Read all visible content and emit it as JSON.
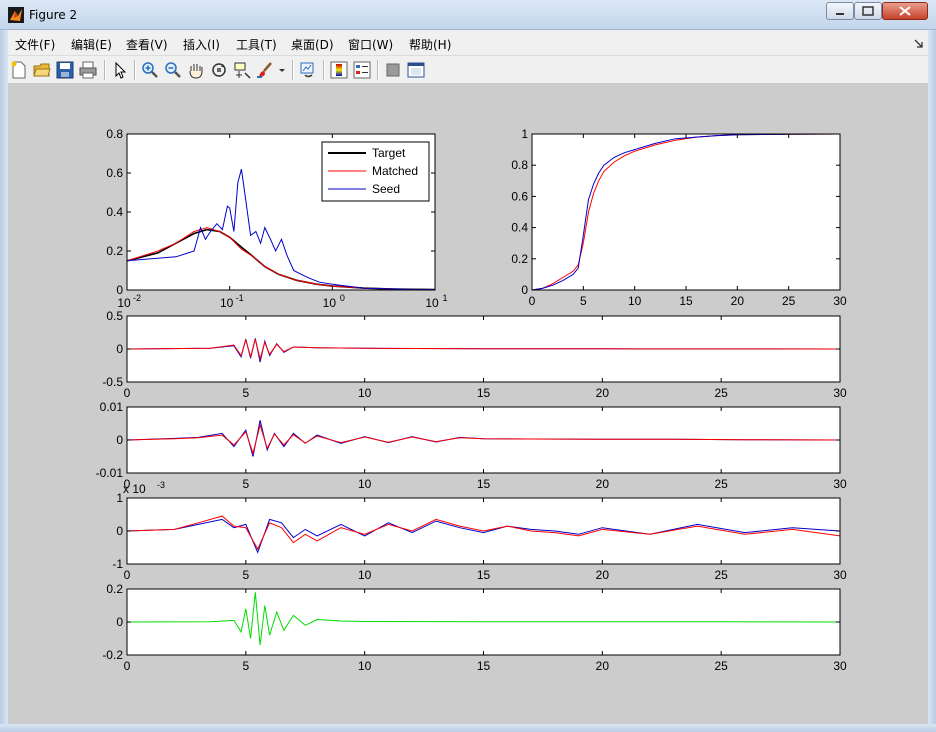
{
  "window": {
    "title": "Figure 2",
    "minimize_icon": "minimize-icon",
    "maximize_icon": "maximize-icon",
    "close_icon": "close-icon"
  },
  "menu": [
    {
      "label": "文件(F)"
    },
    {
      "label": "编辑(E)"
    },
    {
      "label": "查看(V)"
    },
    {
      "label": "插入(I)"
    },
    {
      "label": "工具(T)"
    },
    {
      "label": "桌面(D)"
    },
    {
      "label": "窗口(W)"
    },
    {
      "label": "帮助(H)"
    }
  ],
  "toolbar": {
    "icons": [
      "new-figure-icon",
      "open-file-icon",
      "save-icon",
      "print-icon",
      "arrow-cursor-icon",
      "zoom-in-icon",
      "zoom-out-icon",
      "pan-icon",
      "rotate-3d-icon",
      "data-cursor-icon",
      "brush-icon",
      "dropdown-arrow-icon",
      "link-plot-icon",
      "insert-colorbar-icon",
      "insert-legend-icon",
      "hide-plot-tools-icon",
      "show-plot-tools-icon"
    ]
  },
  "colors": {
    "target": "#000000",
    "matched": "#ff0000",
    "seed": "#0000cc",
    "diff": "#00dd00",
    "figure_bg": "#cccccc"
  },
  "chart_data": [
    {
      "type": "line",
      "xscale": "log",
      "xlim": [
        0.01,
        10
      ],
      "ylim": [
        0,
        0.8
      ],
      "yticks": [
        "0",
        "0.2",
        "0.4",
        "0.6",
        "0.8"
      ],
      "xticks": [
        {
          "base": "10",
          "exp": "-2"
        },
        {
          "base": "10",
          "exp": "-1"
        },
        {
          "base": "10",
          "exp": "0"
        },
        {
          "base": "10",
          "exp": "1"
        }
      ],
      "legend_position": "top-right",
      "series": [
        {
          "name": "Target",
          "color": "#000000",
          "x": [
            0.01,
            0.02,
            0.03,
            0.045,
            0.06,
            0.08,
            0.1,
            0.13,
            0.17,
            0.22,
            0.3,
            0.45,
            0.7,
            1,
            2,
            4,
            10
          ],
          "y": [
            0.15,
            0.19,
            0.24,
            0.29,
            0.31,
            0.3,
            0.27,
            0.22,
            0.17,
            0.12,
            0.08,
            0.05,
            0.03,
            0.02,
            0.01,
            0.005,
            0.002
          ]
        },
        {
          "name": "Matched",
          "color": "#ff0000",
          "x": [
            0.01,
            0.02,
            0.03,
            0.045,
            0.06,
            0.08,
            0.1,
            0.13,
            0.17,
            0.22,
            0.3,
            0.45,
            0.7,
            1,
            2,
            4,
            10
          ],
          "y": [
            0.15,
            0.2,
            0.24,
            0.3,
            0.32,
            0.3,
            0.27,
            0.21,
            0.17,
            0.12,
            0.08,
            0.05,
            0.03,
            0.02,
            0.01,
            0.005,
            0.002
          ]
        },
        {
          "name": "Seed",
          "color": "#0000cc",
          "x": [
            0.01,
            0.03,
            0.045,
            0.052,
            0.058,
            0.065,
            0.075,
            0.085,
            0.095,
            0.1,
            0.11,
            0.12,
            0.13,
            0.14,
            0.16,
            0.18,
            0.2,
            0.22,
            0.25,
            0.28,
            0.32,
            0.36,
            0.42,
            0.5,
            0.6,
            0.75,
            1,
            2,
            4,
            10
          ],
          "y": [
            0.15,
            0.17,
            0.2,
            0.32,
            0.26,
            0.3,
            0.34,
            0.31,
            0.43,
            0.42,
            0.3,
            0.55,
            0.62,
            0.5,
            0.28,
            0.3,
            0.24,
            0.32,
            0.26,
            0.2,
            0.26,
            0.18,
            0.1,
            0.08,
            0.06,
            0.04,
            0.03,
            0.01,
            0.005,
            0.002
          ]
        }
      ]
    },
    {
      "type": "line",
      "xlim": [
        0,
        30
      ],
      "ylim": [
        0,
        1
      ],
      "xticks": [
        "0",
        "5",
        "10",
        "15",
        "20",
        "25",
        "30"
      ],
      "yticks": [
        "0",
        "0.2",
        "0.4",
        "0.6",
        "0.8",
        "1"
      ],
      "series": [
        {
          "color": "#ff0000",
          "x": [
            0,
            1,
            2,
            3,
            4,
            4.5,
            5,
            5.5,
            6,
            6.5,
            7,
            8,
            9,
            10,
            12,
            14,
            16,
            18,
            20,
            25,
            30
          ],
          "y": [
            0,
            0.01,
            0.04,
            0.08,
            0.12,
            0.16,
            0.3,
            0.5,
            0.62,
            0.7,
            0.76,
            0.82,
            0.86,
            0.89,
            0.93,
            0.96,
            0.98,
            0.99,
            0.995,
            0.998,
            1
          ]
        },
        {
          "color": "#0000cc",
          "x": [
            0,
            1,
            2,
            3,
            4,
            4.5,
            5,
            5.5,
            6,
            6.5,
            7,
            8,
            9,
            10,
            12,
            14,
            16,
            18,
            20,
            25,
            30
          ],
          "y": [
            0,
            0.01,
            0.03,
            0.06,
            0.1,
            0.14,
            0.35,
            0.58,
            0.68,
            0.75,
            0.8,
            0.85,
            0.88,
            0.9,
            0.94,
            0.97,
            0.98,
            0.99,
            0.995,
            0.998,
            1
          ]
        }
      ]
    },
    {
      "type": "line",
      "xlim": [
        0,
        30
      ],
      "ylim": [
        -0.5,
        0.5
      ],
      "xticks": [
        "0",
        "5",
        "10",
        "15",
        "20",
        "25",
        "30"
      ],
      "yticks": [
        "-0.5",
        "0",
        "0.5"
      ],
      "series": [
        {
          "color": "#0000cc",
          "x": [
            0,
            3.5,
            4.5,
            4.8,
            5,
            5.2,
            5.4,
            5.6,
            5.8,
            6,
            6.3,
            6.6,
            7,
            8,
            10,
            15,
            20,
            25,
            30
          ],
          "y": [
            0,
            0.01,
            0.05,
            -0.12,
            0.15,
            -0.14,
            0.16,
            -0.2,
            0.12,
            -0.1,
            0.08,
            -0.05,
            0.03,
            0.02,
            0.01,
            0.005,
            0.003,
            0.002,
            0
          ]
        },
        {
          "color": "#ff0000",
          "x": [
            0,
            3.5,
            4.5,
            4.8,
            5,
            5.2,
            5.4,
            5.6,
            5.8,
            6,
            6.3,
            6.6,
            7,
            8,
            10,
            15,
            20,
            25,
            30
          ],
          "y": [
            0,
            0.01,
            0.06,
            -0.1,
            0.14,
            -0.12,
            0.15,
            -0.15,
            0.1,
            -0.08,
            0.07,
            -0.04,
            0.03,
            0.02,
            0.01,
            0.005,
            0.003,
            0.002,
            0
          ]
        }
      ]
    },
    {
      "type": "line",
      "xlim": [
        0,
        30
      ],
      "ylim": [
        -0.01,
        0.01
      ],
      "xticks": [
        "0",
        "5",
        "10",
        "15",
        "20",
        "25",
        "30"
      ],
      "yticks": [
        "-0.01",
        "0",
        "0.01"
      ],
      "series": [
        {
          "color": "#0000cc",
          "x": [
            0,
            2,
            3,
            4,
            4.5,
            5,
            5.3,
            5.6,
            5.9,
            6.2,
            6.6,
            7,
            7.5,
            8,
            9,
            10,
            11,
            12,
            13,
            14,
            15,
            17,
            20,
            23,
            26,
            30
          ],
          "y": [
            0,
            0.0005,
            0.0008,
            0.002,
            -0.002,
            0.003,
            -0.005,
            0.006,
            -0.003,
            0.002,
            -0.002,
            0.002,
            -0.001,
            0.0015,
            -0.001,
            0.001,
            -0.0008,
            0.001,
            -0.0006,
            0.0008,
            0.0004,
            0.0003,
            0.0002,
            0.0002,
            0.0001,
            0
          ]
        },
        {
          "color": "#ff0000",
          "x": [
            0,
            2,
            3,
            4,
            4.5,
            5,
            5.3,
            5.6,
            5.9,
            6.2,
            6.6,
            7,
            7.5,
            8,
            9,
            10,
            11,
            12,
            13,
            14,
            15,
            17,
            20,
            23,
            26,
            30
          ],
          "y": [
            0,
            0.0004,
            0.0007,
            0.0015,
            -0.0015,
            0.0025,
            -0.004,
            0.0045,
            -0.0025,
            0.0018,
            -0.0015,
            0.0016,
            -0.0009,
            0.0012,
            -0.0008,
            0.0009,
            -0.0007,
            0.0009,
            -0.0005,
            0.0007,
            0.0004,
            0.0003,
            0.0002,
            0.0002,
            0.0001,
            0
          ]
        }
      ]
    },
    {
      "type": "line",
      "xlim": [
        0,
        30
      ],
      "ylim": [
        -1,
        1
      ],
      "exponent_label": "x 10",
      "exponent": "-3",
      "xticks": [
        "0",
        "5",
        "10",
        "15",
        "20",
        "25",
        "30"
      ],
      "yticks": [
        "-1",
        "0",
        "1"
      ],
      "series": [
        {
          "color": "#0000cc",
          "x": [
            0,
            2,
            3,
            4,
            4.5,
            5,
            5.5,
            6,
            6.5,
            7,
            7.5,
            8,
            9,
            10,
            11,
            12,
            13,
            14,
            15,
            16,
            17,
            18,
            19,
            20,
            22,
            24,
            26,
            28,
            30
          ],
          "y": [
            0,
            0.05,
            0.2,
            0.35,
            0.1,
            0.2,
            -0.65,
            0.35,
            0.25,
            -0.2,
            0.05,
            -0.15,
            0.2,
            -0.15,
            0.25,
            -0.05,
            0.3,
            0.1,
            -0.05,
            0.15,
            0.05,
            0.0,
            -0.1,
            0.1,
            -0.1,
            0.2,
            -0.05,
            0.1,
            0.0
          ]
        },
        {
          "color": "#ff0000",
          "x": [
            0,
            2,
            3,
            4,
            4.5,
            5,
            5.5,
            6,
            6.5,
            7,
            7.5,
            8,
            9,
            10,
            11,
            12,
            13,
            14,
            15,
            16,
            17,
            18,
            19,
            20,
            22,
            24,
            26,
            28,
            30
          ],
          "y": [
            0,
            0.05,
            0.25,
            0.45,
            0.15,
            0.1,
            -0.55,
            0.25,
            0.1,
            -0.35,
            -0.1,
            -0.3,
            0.1,
            -0.1,
            0.2,
            0.0,
            0.35,
            0.15,
            0.0,
            0.15,
            0.0,
            -0.05,
            -0.15,
            0.05,
            -0.1,
            0.15,
            -0.1,
            0.05,
            -0.15
          ]
        }
      ]
    },
    {
      "type": "line",
      "xlim": [
        0,
        30
      ],
      "ylim": [
        -0.2,
        0.2
      ],
      "xticks": [
        "0",
        "5",
        "10",
        "15",
        "20",
        "25",
        "30"
      ],
      "yticks": [
        "-0.2",
        "0",
        "0.2"
      ],
      "series": [
        {
          "color": "#00dd00",
          "x": [
            0,
            3.5,
            4.5,
            4.8,
            5,
            5.2,
            5.4,
            5.6,
            5.8,
            6,
            6.3,
            6.6,
            7,
            7.5,
            8,
            9,
            10,
            15,
            20,
            25,
            30
          ],
          "y": [
            0,
            0.002,
            0.01,
            -0.06,
            0.08,
            -0.1,
            0.18,
            -0.14,
            0.1,
            -0.08,
            0.06,
            -0.05,
            0.04,
            -0.02,
            0.015,
            0.006,
            0.003,
            0.001,
            0.001,
            0.001,
            0
          ]
        }
      ]
    }
  ]
}
